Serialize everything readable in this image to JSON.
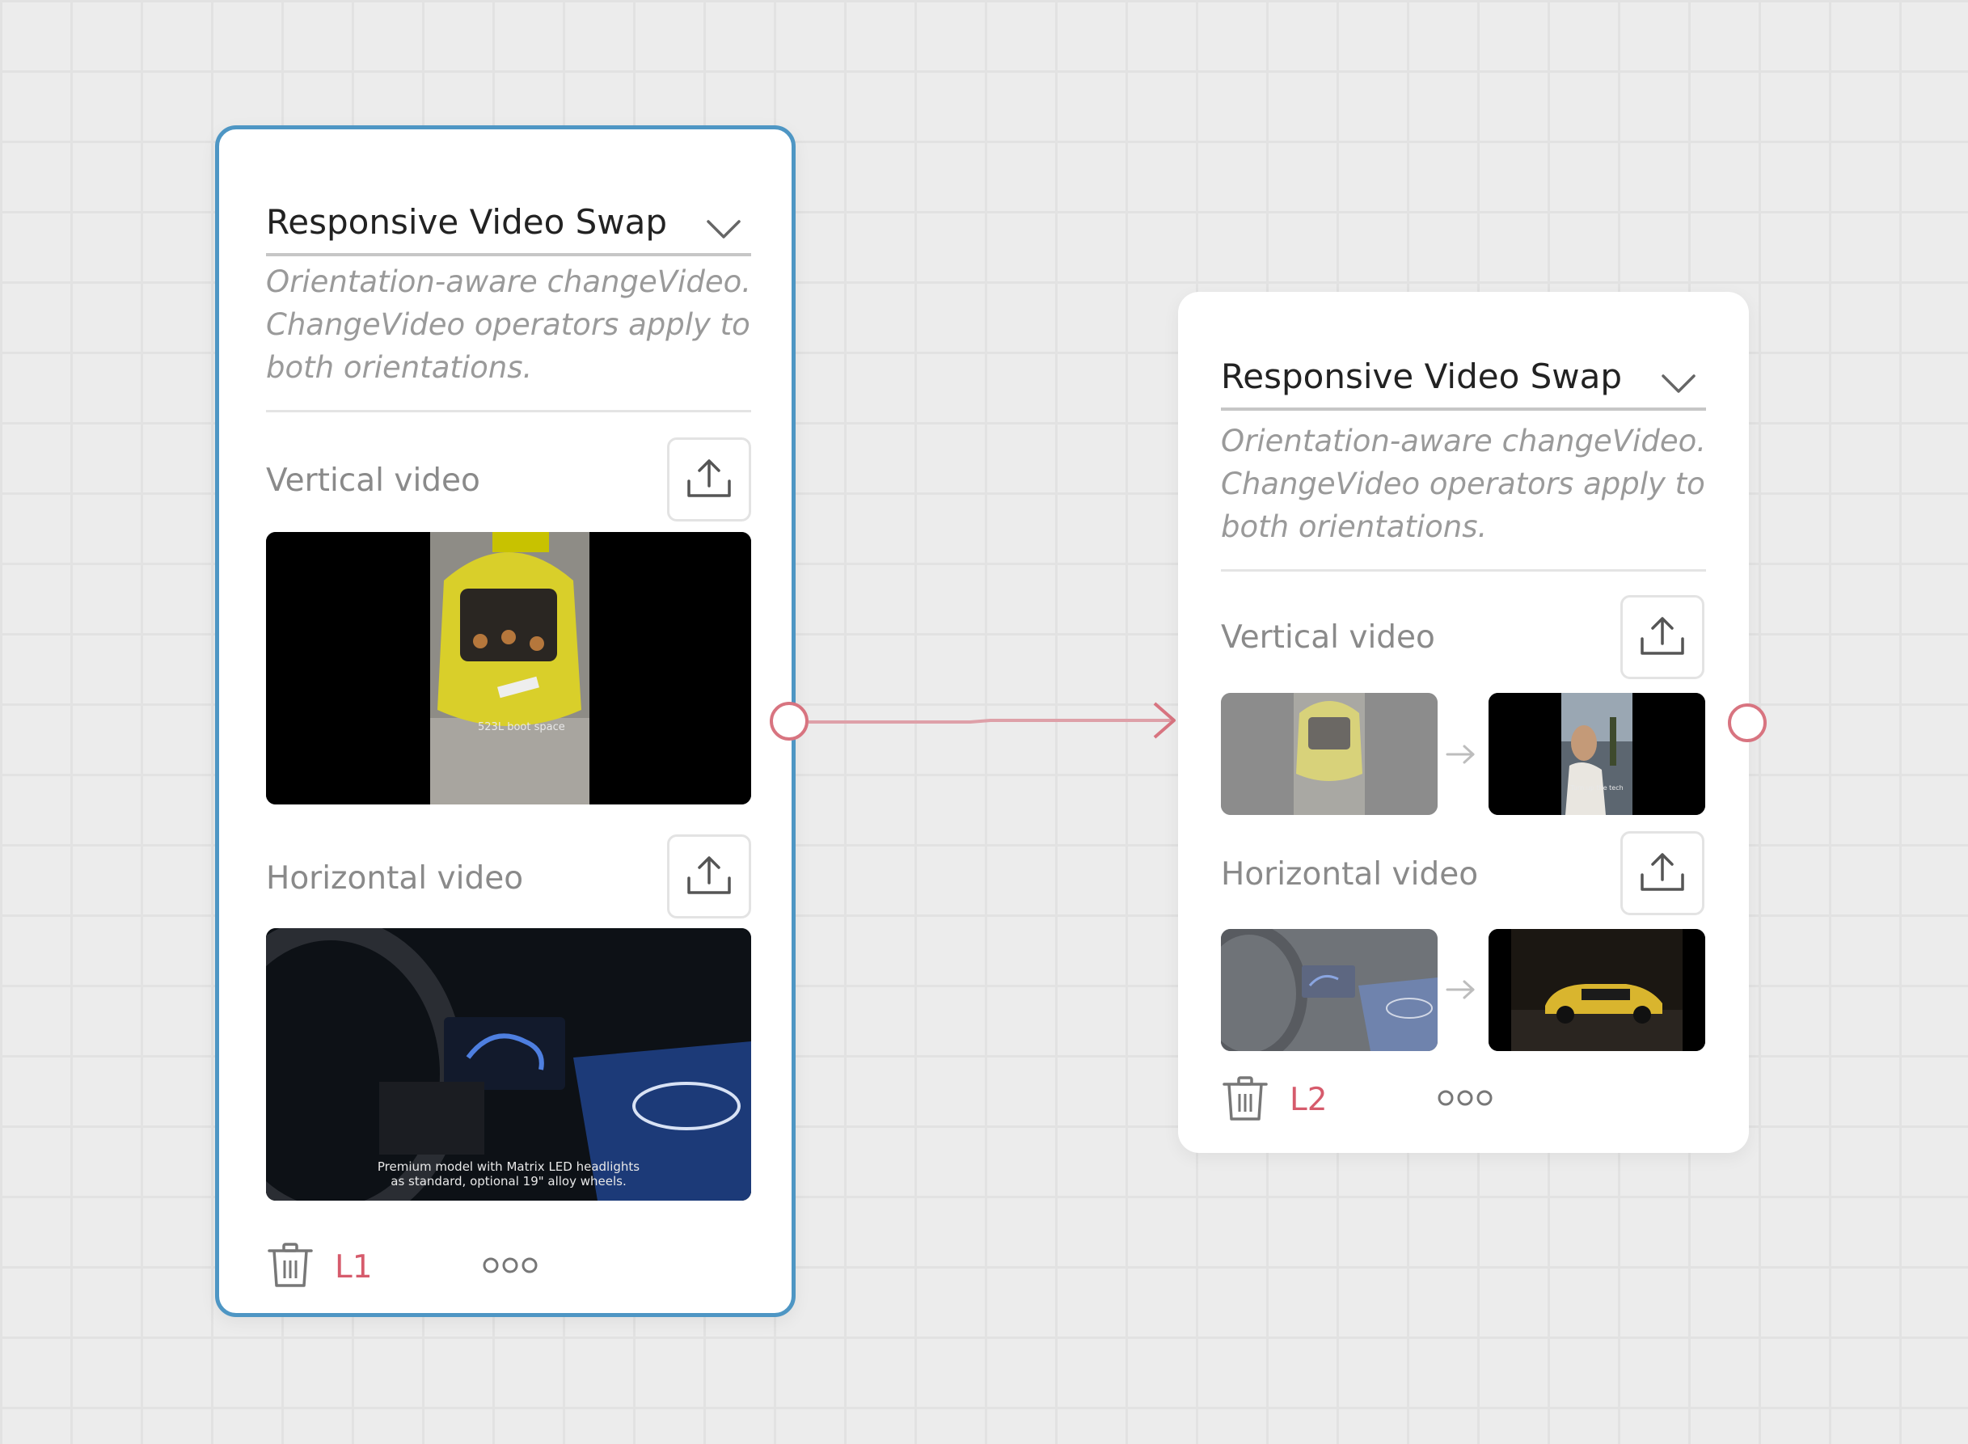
{
  "nodes": [
    {
      "id_label": "L1",
      "title": "Responsive Video Swap",
      "description": "Orientation-aware changeVideo. ChangeVideo operators apply to both orientations.",
      "vertical_label": "Vertical video",
      "horizontal_label": "Horizontal video",
      "vertical_caption": "523L boot space",
      "horizontal_caption_1": "Premium model with Matrix LED headlights",
      "horizontal_caption_2": "as standard, optional 19\" alloy wheels."
    },
    {
      "id_label": "L2",
      "title": "Responsive Video Swap",
      "description": "Orientation-aware changeVideo. ChangeVideo operators apply to both orientations.",
      "vertical_label": "Vertical video",
      "horizontal_label": "Horizontal video",
      "vertical_new_caption": "Turn up the tech"
    }
  ],
  "colors": {
    "selected_border": "#4e96c4",
    "connector": "#d87480",
    "layer_label": "#d65b6c"
  },
  "icons": [
    "chevron-down-icon",
    "upload-icon",
    "trash-icon",
    "more-icon",
    "arrow-right-icon"
  ]
}
